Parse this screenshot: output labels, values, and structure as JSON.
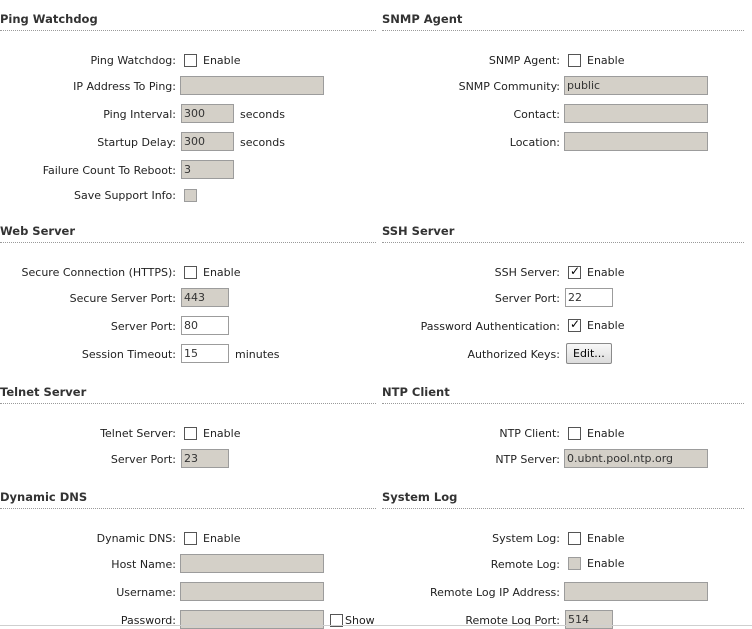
{
  "ping": {
    "title": "Ping Watchdog",
    "watchdog_label": "Ping Watchdog:",
    "enable": "Enable",
    "ip_label": "IP Address To Ping:",
    "ip_value": "",
    "interval_label": "Ping Interval:",
    "interval_value": "300",
    "seconds": "seconds",
    "startup_label": "Startup Delay:",
    "startup_value": "300",
    "seconds2": "seconds",
    "failure_label": "Failure Count To Reboot:",
    "failure_value": "3",
    "save_label": "Save Support Info:"
  },
  "snmp": {
    "title": "SNMP Agent",
    "agent_label": "SNMP Agent:",
    "enable": "Enable",
    "community_label": "SNMP Community:",
    "community_value": "public",
    "contact_label": "Contact:",
    "contact_value": "",
    "location_label": "Location:",
    "location_value": ""
  },
  "web": {
    "title": "Web Server",
    "secure_label": "Secure Connection (HTTPS):",
    "enable": "Enable",
    "secure_port_label": "Secure Server Port:",
    "secure_port_value": "443",
    "port_label": "Server Port:",
    "port_value": "80",
    "timeout_label": "Session Timeout:",
    "timeout_value": "15",
    "minutes": "minutes"
  },
  "ssh": {
    "title": "SSH Server",
    "server_label": "SSH Server:",
    "enable": "Enable",
    "port_label": "Server Port:",
    "port_value": "22",
    "pass_label": "Password Authentication:",
    "enable2": "Enable",
    "keys_label": "Authorized Keys:",
    "edit_button": "Edit..."
  },
  "telnet": {
    "title": "Telnet Server",
    "server_label": "Telnet Server:",
    "enable": "Enable",
    "port_label": "Server Port:",
    "port_value": "23"
  },
  "ntp": {
    "title": "NTP Client",
    "client_label": "NTP Client:",
    "enable": "Enable",
    "server_label": "NTP Server:",
    "server_value": "0.ubnt.pool.ntp.org"
  },
  "ddns": {
    "title": "Dynamic DNS",
    "ddns_label": "Dynamic DNS:",
    "enable": "Enable",
    "host_label": "Host Name:",
    "host_value": "",
    "user_label": "Username:",
    "user_value": "",
    "pass_label": "Password:",
    "pass_value": "",
    "show": "Show"
  },
  "syslog": {
    "title": "System Log",
    "log_label": "System Log:",
    "enable": "Enable",
    "remote_label": "Remote Log:",
    "enable2": "Enable",
    "remote_ip_label": "Remote Log IP Address:",
    "remote_ip_value": "",
    "remote_port_label": "Remote Log Port:",
    "remote_port_value": "514"
  }
}
